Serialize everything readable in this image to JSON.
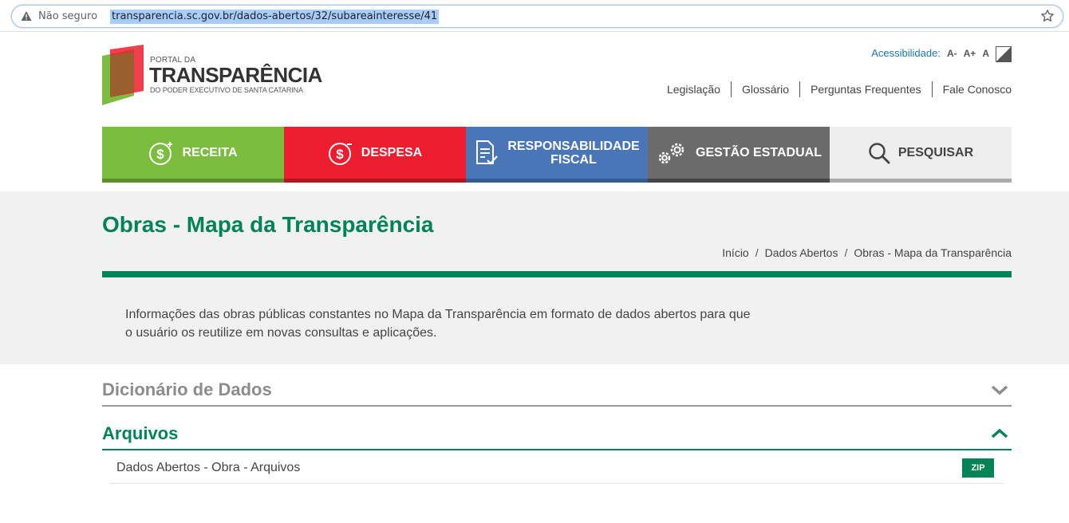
{
  "browser": {
    "security_label": "Não seguro",
    "url": "transparencia.sc.gov.br/dados-abertos/32/subareainteresse/41"
  },
  "header": {
    "logo_small": "PORTAL DA",
    "logo_big": "TRANSPARÊNCIA",
    "logo_sub": "DO PODER EXECUTIVO DE SANTA CATARINA",
    "accessibility_label": "Acessibilidade:",
    "font_decrease": "A-",
    "font_increase": "A+",
    "font_reset": "A",
    "links": [
      "Legislação",
      "Glossário",
      "Perguntas Frequentes",
      "Fale Conosco"
    ]
  },
  "nav": {
    "receita": "RECEITA",
    "despesa": "DESPESA",
    "resp_line1": "RESPONSABILIDADE",
    "resp_line2": "FISCAL",
    "gestao": "GESTÃO ESTADUAL",
    "pesquisar": "PESQUISAR"
  },
  "page": {
    "title": "Obras - Mapa da Transparência",
    "breadcrumb": [
      "Início",
      "Dados Abertos",
      "Obras - Mapa da Transparência"
    ],
    "description": "Informações das obras públicas constantes no Mapa da Transparência em formato de dados abertos para que o usuário os reutilize em novas consultas e aplicações."
  },
  "sections": {
    "dictionary_title": "Dicionário de Dados",
    "files_title": "Arquivos",
    "file_name": "Dados Abertos - Obra - Arquivos",
    "file_format": "ZIP"
  },
  "colors": {
    "brand_green": "#008455",
    "receita": "#7cbd3f",
    "despesa": "#ed1c2e",
    "responsabilidade": "#4a76b8",
    "gestao": "#6b6b6b",
    "pesquisar": "#eeeeee"
  }
}
